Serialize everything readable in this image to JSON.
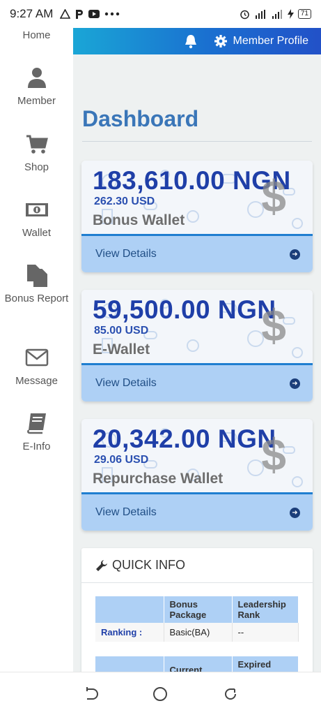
{
  "status": {
    "time": "9:27 AM",
    "battery": "71"
  },
  "sidebar": {
    "home_label": "Home",
    "items": [
      {
        "label": "Member",
        "icon": "user-icon"
      },
      {
        "label": "Shop",
        "icon": "cart-icon"
      },
      {
        "label": "Wallet",
        "icon": "money-icon"
      },
      {
        "label": "Bonus Report",
        "icon": "copy-icon"
      },
      {
        "label": "Message",
        "icon": "envelope-icon"
      },
      {
        "label": "E-Info",
        "icon": "book-icon"
      }
    ]
  },
  "header": {
    "profile_label": "Member Profile"
  },
  "main": {
    "title": "Dashboard",
    "cards": [
      {
        "amount": "183,610.00 NGN",
        "usd": "262.30 USD",
        "name": "Bonus Wallet",
        "link": "View Details"
      },
      {
        "amount": "59,500.00 NGN",
        "usd": "85.00 USD",
        "name": "E-Wallet",
        "link": "View Details"
      },
      {
        "amount": "20,342.00 NGN",
        "usd": "29.06 USD",
        "name": "Repurchase Wallet",
        "link": "View Details"
      }
    ],
    "dollar_glyph": "$",
    "quick_info": {
      "title": "QUICK INFO",
      "headers": [
        "",
        "Bonus Package",
        "Leadership Rank"
      ],
      "row_label": "Ranking :",
      "row_values": [
        "Basic(BA)",
        "--"
      ],
      "headers2": [
        "",
        "Current",
        "Expired Date"
      ]
    }
  },
  "colors": {
    "accent": "#1f3fa8",
    "card_footer": "#aed0f5",
    "title": "#3a76b8"
  }
}
